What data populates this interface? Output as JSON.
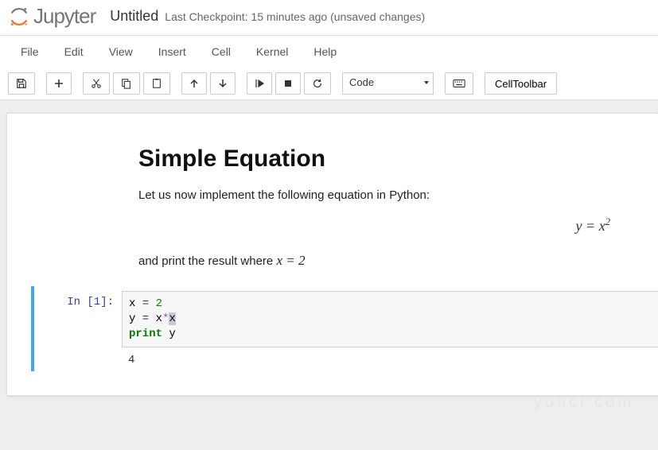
{
  "logo": {
    "text": "Jupyter"
  },
  "title": "Untitled",
  "checkpoint": "Last Checkpoint: 15 minutes ago (unsaved changes)",
  "menu": {
    "file": "File",
    "edit": "Edit",
    "view": "View",
    "insert": "Insert",
    "cell": "Cell",
    "kernel": "Kernel",
    "help": "Help"
  },
  "toolbar": {
    "cell_type": "Code",
    "cell_toolbar": "CellToolbar"
  },
  "content": {
    "heading": "Simple Equation",
    "para1": "Let us now implement the following equation in Python:",
    "equation_display": "y = x²",
    "para2_prefix": "and print the result where ",
    "para2_eq": "x = 2"
  },
  "code_cell": {
    "prompt": "In [1]:",
    "line1_var": "x",
    "line1_eq": " = ",
    "line1_num": "2",
    "line2_var1": "y",
    "line2_eq": " = ",
    "line2_var2": "x",
    "line2_op": "*",
    "line2_var3": "x",
    "line3_kw": "print",
    "line3_sp": " ",
    "line3_var": "y",
    "output": "4"
  },
  "watermark": "youci.com"
}
